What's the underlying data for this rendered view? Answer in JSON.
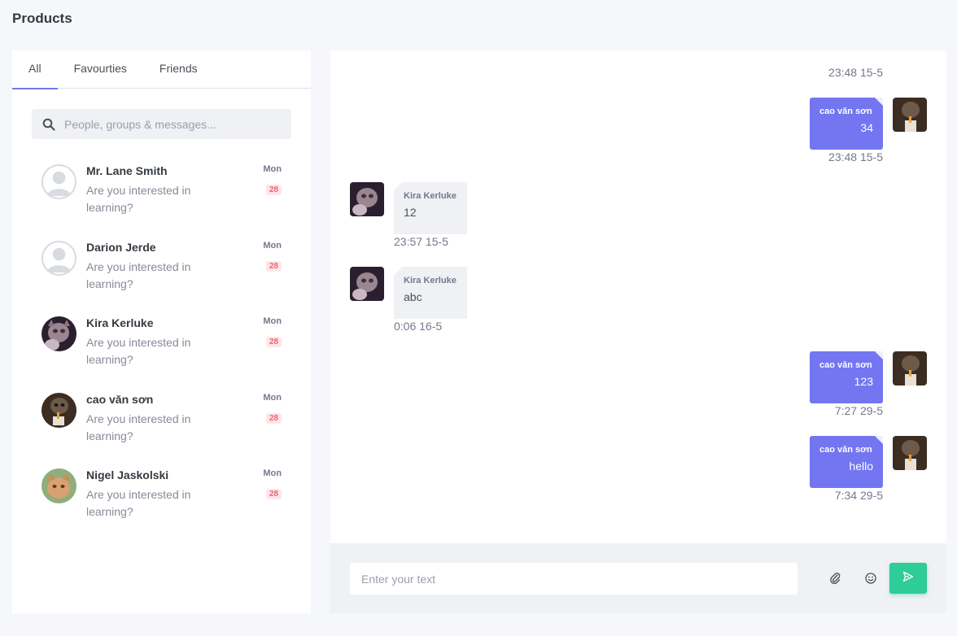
{
  "page": {
    "title": "Products"
  },
  "tabs": [
    {
      "label": "All",
      "active": true
    },
    {
      "label": "Favourties",
      "active": false
    },
    {
      "label": "Friends",
      "active": false
    }
  ],
  "search": {
    "placeholder": "People, groups & messages..."
  },
  "contacts": [
    {
      "name": "Mr. Lane Smith",
      "message": "Are you interested in learning?",
      "day": "Mon",
      "badge": "28",
      "avatar": "default"
    },
    {
      "name": "Darion Jerde",
      "message": "Are you interested in learning?",
      "day": "Mon",
      "badge": "28",
      "avatar": "default"
    },
    {
      "name": "Kira Kerluke",
      "message": "Are you interested in learning?",
      "day": "Mon",
      "badge": "28",
      "avatar": "photo-cat"
    },
    {
      "name": "cao văn sơn",
      "message": "Are you interested in learning?",
      "day": "Mon",
      "badge": "28",
      "avatar": "photo-kitten"
    },
    {
      "name": "Nigel Jaskolski",
      "message": "Are you interested in learning?",
      "day": "Mon",
      "badge": "28",
      "avatar": "photo-orange-cat"
    }
  ],
  "messages": [
    {
      "direction": "out",
      "sender": "cao văn sơn",
      "text": "34",
      "time": "23:48 15-5"
    },
    {
      "direction": "in",
      "sender": "Kira Kerluke",
      "text": "12",
      "time": "23:57 15-5"
    },
    {
      "direction": "in",
      "sender": "Kira Kerluke",
      "text": "abc",
      "time": "0:06 16-5"
    },
    {
      "direction": "out",
      "sender": "cao văn sơn",
      "text": "123",
      "time": "7:27 29-5"
    },
    {
      "direction": "out",
      "sender": "cao văn sơn",
      "text": "hello",
      "time": "7:34 29-5"
    }
  ],
  "top_partial_time": "23:48 15-5",
  "composer": {
    "placeholder": "Enter your text"
  },
  "icons": {
    "search": "search-icon",
    "attach": "paperclip-icon",
    "emoji": "smile-icon",
    "send": "send-icon"
  },
  "colors": {
    "accent": "#7376f0",
    "send": "#2ecc97",
    "badge": "#f06570"
  }
}
